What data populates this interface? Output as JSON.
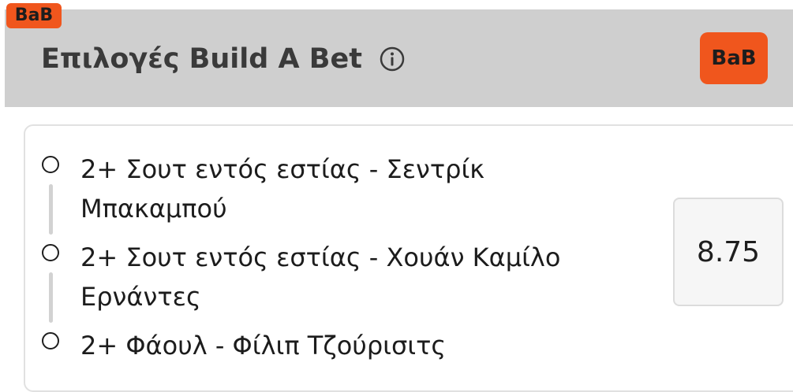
{
  "badge": {
    "label": "BaB"
  },
  "header": {
    "title": "Επιλογές Build A Bet",
    "info_icon": "info-icon",
    "bab_button_label": "BaB"
  },
  "selections": [
    {
      "text": "2+ Σουτ εντός εστίας - Σεντρίκ Μπακαμπού"
    },
    {
      "text": "2+ Σουτ εντός εστίας - Χουάν Καμίλο Ερνάντες"
    },
    {
      "text": "2+ Φάουλ - Φίλιπ Τζούρισιτς"
    }
  ],
  "odds": {
    "value": "8.75"
  },
  "colors": {
    "accent": "#f0561d",
    "header_bg": "#cfcfcf",
    "card_border": "#e1e1e1"
  }
}
